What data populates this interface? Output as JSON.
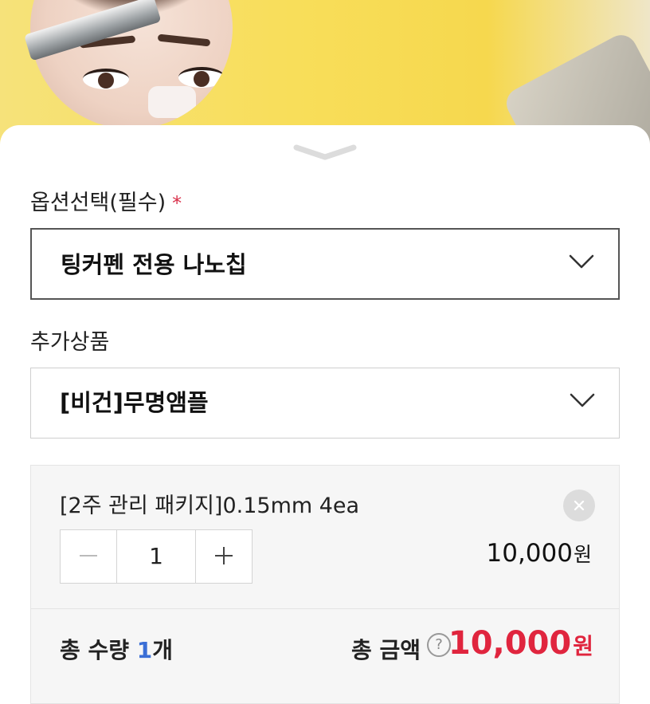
{
  "colors": {
    "accent_red": "#d9304a",
    "total_red": "#e0253e",
    "count_blue": "#3b6fd6",
    "banner_yellow": "#f8de5a"
  },
  "option": {
    "label": "옵션선택(필수)",
    "required_mark": "*",
    "selected": "팅커펜 전용 나노칩"
  },
  "addon": {
    "label": "추가상품",
    "selected": "[비건]무명앰플"
  },
  "cart_item": {
    "name": "[2주 관리 패키지]0.15mm 4ea",
    "quantity": "1",
    "price": "10,000",
    "price_unit": "원"
  },
  "summary": {
    "qty_label": "총 수량 ",
    "qty_value": "1",
    "qty_unit": "개",
    "amount_label": "총 금액",
    "help": "?",
    "total": "10,000",
    "total_unit": "원"
  }
}
